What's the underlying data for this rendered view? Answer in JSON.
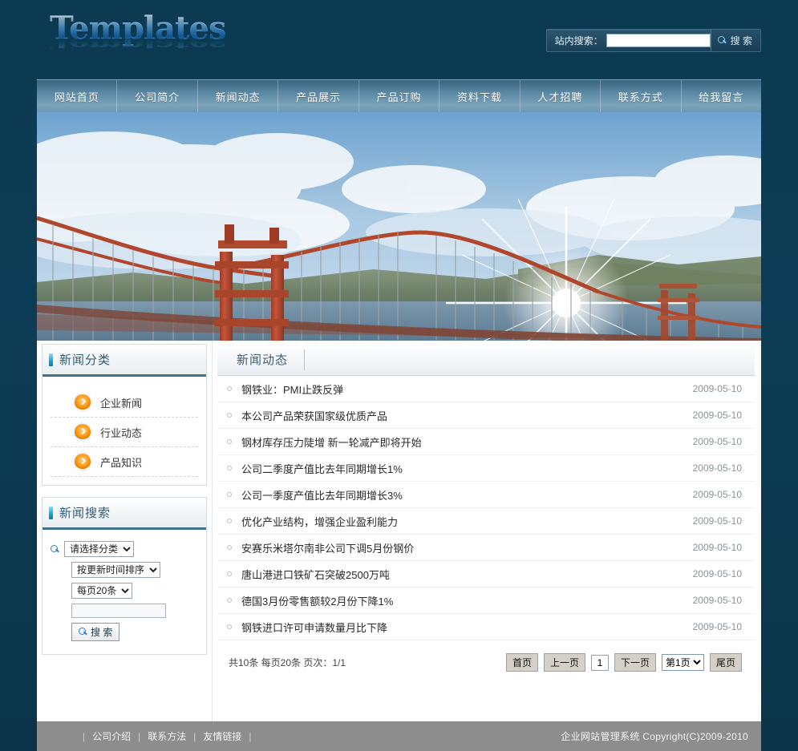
{
  "site": {
    "logo_text": "Templates",
    "background_color": "#0c3a51",
    "nav_accent": "#5a87a2",
    "panel_accent": "#43708d",
    "bullet_color": "#ff9d17"
  },
  "header": {
    "search_label": "站内搜索：",
    "search_value": "",
    "search_placeholder": "",
    "search_button": "搜 索",
    "search_icon": "search-icon"
  },
  "nav": {
    "items": [
      {
        "label": "网站首页"
      },
      {
        "label": "公司简介"
      },
      {
        "label": "新闻动态"
      },
      {
        "label": "产品展示"
      },
      {
        "label": "产品订购"
      },
      {
        "label": "资料下载"
      },
      {
        "label": "人才招聘"
      },
      {
        "label": "联系方式"
      },
      {
        "label": "给我留言"
      }
    ]
  },
  "banner": {
    "alt": "golden-gate-bridge-photo"
  },
  "sidebar": {
    "category_panel": {
      "title": "新闻分类",
      "items": [
        {
          "label": "企业新闻",
          "icon": "arrow-circle-icon"
        },
        {
          "label": "行业动态",
          "icon": "arrow-circle-icon"
        },
        {
          "label": "产品知识",
          "icon": "arrow-circle-icon"
        }
      ]
    },
    "search_panel": {
      "title": "新闻搜索",
      "icon": "search-icon",
      "category_select": "请选择分类",
      "sort_select": "按更新时间排序",
      "perpage_select": "每页20条",
      "keyword_value": "",
      "keyword_placeholder": "",
      "search_button": "搜 索"
    }
  },
  "content": {
    "tab_label": "新闻动态",
    "news": [
      {
        "title": "钢铁业：PMI止跌反弹",
        "date": "2009-05-10"
      },
      {
        "title": "本公司产品荣获国家级优质产品",
        "date": "2009-05-10"
      },
      {
        "title": "钢材库存压力陡增 新一轮减产即将开始",
        "date": "2009-05-10"
      },
      {
        "title": "公司二季度产值比去年同期增长1%",
        "date": "2009-05-10"
      },
      {
        "title": "公司一季度产值比去年同期增长3%",
        "date": "2009-05-10"
      },
      {
        "title": "优化产业结构，增强企业盈利能力",
        "date": "2009-05-10"
      },
      {
        "title": "安赛乐米塔尔南非公司下调5月份钢价",
        "date": "2009-05-10"
      },
      {
        "title": "唐山港进口铁矿石突破2500万吨",
        "date": "2009-05-10"
      },
      {
        "title": "德国3月份零售额较2月份下降1%",
        "date": "2009-05-10"
      },
      {
        "title": "钢铁进口许可申请数量月比下降",
        "date": "2009-05-10"
      }
    ],
    "pager": {
      "info": "共10条 每页20条 页次：1/1",
      "first": "首页",
      "prev": "上一页",
      "current": "1",
      "next": "下一页",
      "page_select": "第1页",
      "last": "尾页"
    }
  },
  "footer": {
    "links": [
      {
        "label": "公司介绍"
      },
      {
        "label": "联系方法"
      },
      {
        "label": "友情链接"
      }
    ],
    "copyright": "企业网站管理系统  Copyright(C)2009-2010"
  }
}
